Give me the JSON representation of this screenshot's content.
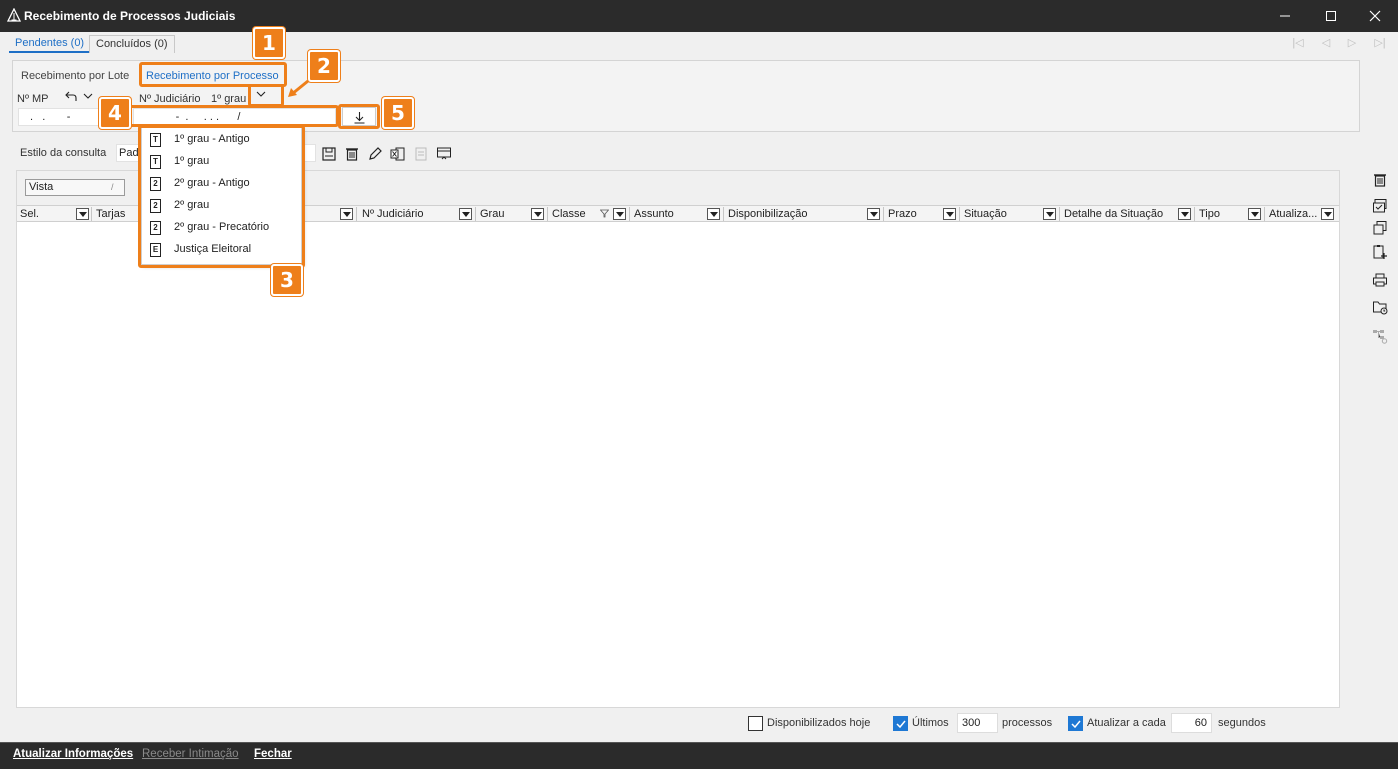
{
  "window": {
    "title": "Recebimento de Processos Judiciais",
    "controls": {
      "minimize": "minimize-icon",
      "maximize": "maximize-icon",
      "close": "close-icon"
    }
  },
  "tabs": [
    {
      "label": "Pendentes (0)",
      "selected": true
    },
    {
      "label": "Concluídos (0)",
      "selected": false
    }
  ],
  "filter": {
    "subtabs": [
      {
        "label": "Recebimento por Lote",
        "selected": false
      },
      {
        "label": "Recebimento por Processo",
        "selected": true
      }
    ],
    "mp_label": "Nº MP",
    "mp_value": " .   .       -",
    "judiciario_label": "Nº Judiciário",
    "grau_value": "1º grau",
    "judiciario_value": "           -  .     . . .      /"
  },
  "grau_options": [
    {
      "icon": "T",
      "label": "1º grau - Antigo"
    },
    {
      "icon": "T",
      "label": "1º grau"
    },
    {
      "icon": "2",
      "label": "2º grau - Antigo"
    },
    {
      "icon": "2",
      "label": "2º grau"
    },
    {
      "icon": "2",
      "label": "2º grau - Precatório"
    },
    {
      "icon": "E",
      "label": "Justiça Eleitoral"
    }
  ],
  "annotations": [
    "1",
    "2",
    "3",
    "4",
    "5"
  ],
  "toolbar": {
    "estilo_label": "Estilo da consulta",
    "estilo_value": "Padr"
  },
  "grid": {
    "vista_label": "Vista",
    "vista_sep": "/",
    "columns": [
      "Sel.",
      "Tarjas",
      "Nº Judiciário",
      "Grau",
      "Classe",
      "Assunto",
      "Disponibilização",
      "Prazo",
      "Situação",
      "Detalhe da Situação",
      "Tipo",
      "Atualiza..."
    ]
  },
  "footer": {
    "disponibilizados_label": "Disponibilizados hoje",
    "disponibilizados_checked": false,
    "ultimos_label": "Últimos",
    "ultimos_checked": true,
    "ultimos_value": "300",
    "processos_label": "processos",
    "atualizar_label": "Atualizar a cada",
    "atualizar_checked": true,
    "atualizar_value": "60",
    "segundos_label": "segundos"
  },
  "status_bar": {
    "atualizar": "Atualizar Informações",
    "receber": "Receber Intimação",
    "fechar": "Fechar"
  },
  "colors": {
    "accent": "#1e6fc6",
    "annotation": "#ee7f1a",
    "titlebar": "#2b2b2b"
  }
}
